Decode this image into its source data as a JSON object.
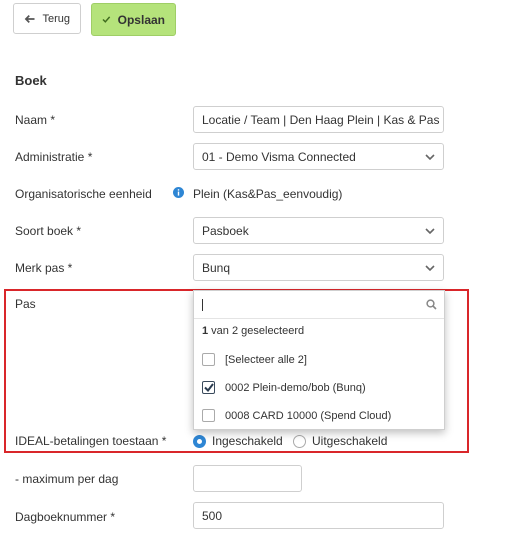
{
  "toolbar": {
    "back_label": "Terug",
    "save_label": "Opslaan"
  },
  "section_title": "Boek",
  "form": {
    "naam": {
      "label": "Naam *",
      "value": "Locatie / Team | Den Haag Plein | Kas & Pas eenvoudig"
    },
    "administratie": {
      "label": "Administratie *",
      "value": "01 - Demo Visma Connected"
    },
    "org_eenheid": {
      "label": "Organisatorische eenheid",
      "value": "Plein (Kas&Pas_eenvoudig)"
    },
    "soort_boek": {
      "label": "Soort boek *",
      "value": "Pasboek"
    },
    "merk_pas": {
      "label": "Merk pas *",
      "value": "Bunq"
    },
    "pas": {
      "label": "Pas",
      "search_value": ""
    },
    "ideal": {
      "label": "IDEAL-betalingen toestaan *",
      "options": [
        "Ingeschakeld",
        "Uitgeschakeld"
      ],
      "selected": "Ingeschakeld"
    },
    "maximum": {
      "label": "- maximum per dag",
      "value": ""
    },
    "dagboeknummer": {
      "label": "Dagboeknummer *",
      "value": "500"
    }
  },
  "dropdown": {
    "status_count": "1",
    "status_text": " van 2 geselecteerd",
    "items": [
      {
        "label": "[Selecteer alle 2]",
        "checked": false
      },
      {
        "label": "0002 Plein-demo/bob (Bunq)",
        "checked": true
      },
      {
        "label": "0008 CARD 10000 (Spend Cloud)",
        "checked": false
      }
    ]
  },
  "colors": {
    "save_bg": "#b5e37b",
    "highlight": "#d9262a",
    "radio_on": "#2e86d4",
    "info_icon": "#2e86d4"
  }
}
